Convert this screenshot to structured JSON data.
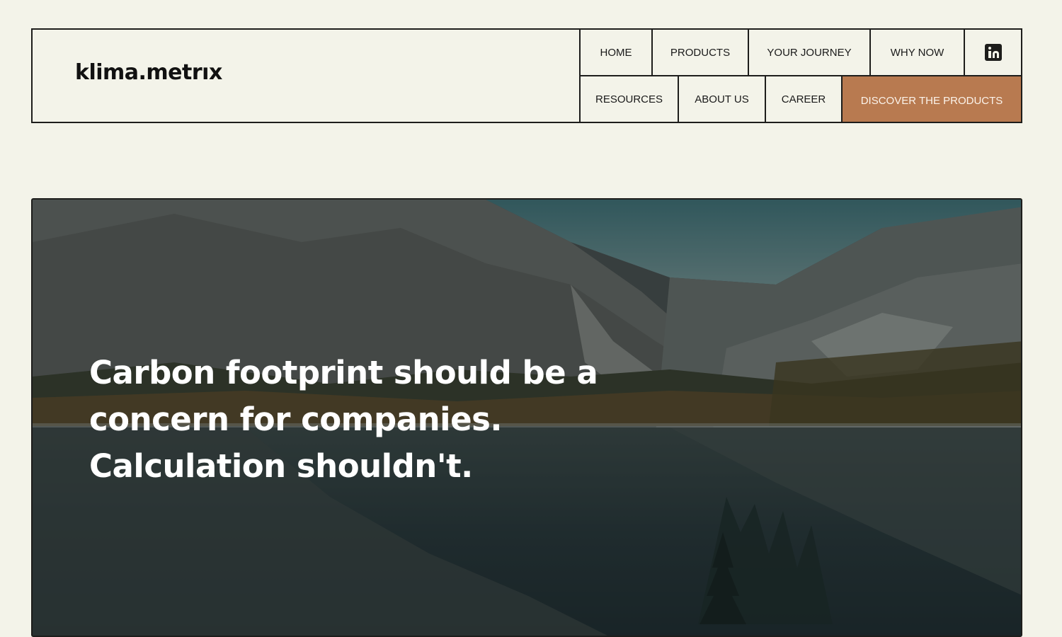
{
  "brand": {
    "logo_text": "klima.metrıx"
  },
  "nav": {
    "top": [
      {
        "label": "HOME"
      },
      {
        "label": "PRODUCTS"
      },
      {
        "label": "YOUR JOURNEY"
      },
      {
        "label": "WHY NOW"
      }
    ],
    "social_icon": "linkedin-icon",
    "bottom": [
      {
        "label": "RESOURCES"
      },
      {
        "label": "ABOUT US"
      },
      {
        "label": "CAREER"
      }
    ],
    "cta_label": "DISCOVER THE PRODUCTS"
  },
  "hero": {
    "title_line1": "Carbon footprint should be a",
    "title_line2": "concern for companies.",
    "title_line3": "Calculation shouldn't."
  },
  "colors": {
    "background": "#f3f3e9",
    "border": "#1d1d1b",
    "cta": "#b87a50",
    "hero_text": "#ffffff"
  }
}
